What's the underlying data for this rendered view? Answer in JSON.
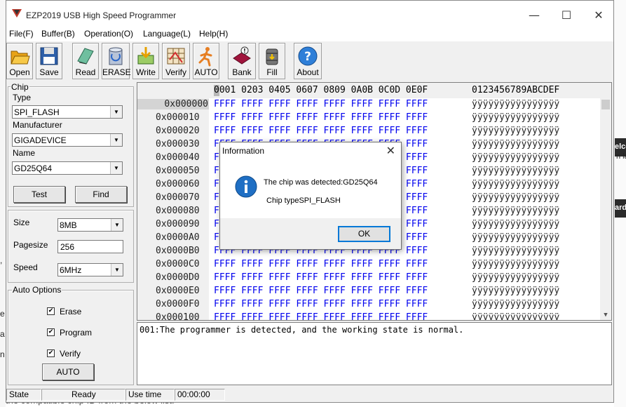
{
  "window": {
    "title": "EZP2019 USB High Speed Programmer",
    "minimize_glyph": "—",
    "maximize_glyph": "☐",
    "close_glyph": "✕"
  },
  "menu": [
    "File(F)",
    "Buffer(B)",
    "Operation(O)",
    "Language(L)",
    "Help(H)"
  ],
  "toolbar": {
    "open": "Open",
    "save": "Save",
    "read": "Read",
    "erase": "ERASE",
    "write": "Write",
    "verify": "Verify",
    "auto": "AUTO",
    "bank": "Bank",
    "fill": "Fill",
    "about": "About"
  },
  "chip": {
    "group_title": "Chip",
    "type_label": "Type",
    "type_value": "SPI_FLASH",
    "manufacturer_label": "Manufacturer",
    "manufacturer_value": "GIGADEVICE",
    "name_label": "Name",
    "name_value": "GD25Q64",
    "test_button": "Test",
    "find_button": "Find"
  },
  "params": {
    "size_label": "Size",
    "size_value": "8MB",
    "pagesize_label": "Pagesize",
    "pagesize_value": "256",
    "speed_label": "Speed",
    "speed_value": "6MHz"
  },
  "auto_options": {
    "group_title": "Auto Options",
    "erase": "Erase",
    "program": "Program",
    "verify": "Verify",
    "check_glyph": "✔",
    "auto_button": "AUTO"
  },
  "hex": {
    "header_offsets": "0001 0203 0405 0607 0809 0A0B 0C0D 0E0F",
    "header_ascii": "0123456789ABCDEF",
    "rows": [
      {
        "addr": "0x000000",
        "data": "FFFF FFFF FFFF FFFF FFFF FFFF FFFF FFFF",
        "ascii": "ÿÿÿÿÿÿÿÿÿÿÿÿÿÿÿÿ"
      },
      {
        "addr": "0x000010",
        "data": "FFFF FFFF FFFF FFFF FFFF FFFF FFFF FFFF",
        "ascii": "ÿÿÿÿÿÿÿÿÿÿÿÿÿÿÿÿ"
      },
      {
        "addr": "0x000020",
        "data": "FFFF FFFF FFFF FFFF FFFF FFFF FFFF FFFF",
        "ascii": "ÿÿÿÿÿÿÿÿÿÿÿÿÿÿÿÿ"
      },
      {
        "addr": "0x000030",
        "data": "FFFF FFFF FFFF FFFF FFFF FFFF FFFF FFFF",
        "ascii": "ÿÿÿÿÿÿÿÿÿÿÿÿÿÿÿÿ"
      },
      {
        "addr": "0x000040",
        "data": "FFFF FFFF FFFF FFFF FFFF FFFF FFFF FFFF",
        "ascii": "ÿÿÿÿÿÿÿÿÿÿÿÿÿÿÿÿ"
      },
      {
        "addr": "0x000050",
        "data": "FFFF FFFF FFFF FFFF FFFF FFFF FFFF FFFF",
        "ascii": "ÿÿÿÿÿÿÿÿÿÿÿÿÿÿÿÿ"
      },
      {
        "addr": "0x000060",
        "data": "FFFF FFFF FFFF FFFF FFFF FFFF FFFF FFFF",
        "ascii": "ÿÿÿÿÿÿÿÿÿÿÿÿÿÿÿÿ"
      },
      {
        "addr": "0x000070",
        "data": "FFFF FFFF FFFF FFFF FFFF FFFF FFFF FFFF",
        "ascii": "ÿÿÿÿÿÿÿÿÿÿÿÿÿÿÿÿ"
      },
      {
        "addr": "0x000080",
        "data": "FFFF FFFF FFFF FFFF FFFF FFFF FFFF FFFF",
        "ascii": "ÿÿÿÿÿÿÿÿÿÿÿÿÿÿÿÿ"
      },
      {
        "addr": "0x000090",
        "data": "FFFF FFFF FFFF FFFF FFFF FFFF FFFF FFFF",
        "ascii": "ÿÿÿÿÿÿÿÿÿÿÿÿÿÿÿÿ"
      },
      {
        "addr": "0x0000A0",
        "data": "FFFF FFFF FFFF FFFF FFFF FFFF FFFF FFFF",
        "ascii": "ÿÿÿÿÿÿÿÿÿÿÿÿÿÿÿÿ"
      },
      {
        "addr": "0x0000B0",
        "data": "FFFF FFFF FFFF FFFF FFFF FFFF FFFF FFFF",
        "ascii": "ÿÿÿÿÿÿÿÿÿÿÿÿÿÿÿÿ"
      },
      {
        "addr": "0x0000C0",
        "data": "FFFF FFFF FFFF FFFF FFFF FFFF FFFF FFFF",
        "ascii": "ÿÿÿÿÿÿÿÿÿÿÿÿÿÿÿÿ"
      },
      {
        "addr": "0x0000D0",
        "data": "FFFF FFFF FFFF FFFF FFFF FFFF FFFF FFFF",
        "ascii": "ÿÿÿÿÿÿÿÿÿÿÿÿÿÿÿÿ"
      },
      {
        "addr": "0x0000E0",
        "data": "FFFF FFFF FFFF FFFF FFFF FFFF FFFF FFFF",
        "ascii": "ÿÿÿÿÿÿÿÿÿÿÿÿÿÿÿÿ"
      },
      {
        "addr": "0x0000F0",
        "data": "FFFF FFFF FFFF FFFF FFFF FFFF FFFF FFFF",
        "ascii": "ÿÿÿÿÿÿÿÿÿÿÿÿÿÿÿÿ"
      },
      {
        "addr": "0x000100",
        "data": "FFFF FFFF FFFF FFFF FFFF FFFF FFFF FFFF",
        "ascii": "ÿÿÿÿÿÿÿÿÿÿÿÿÿÿÿÿ"
      }
    ]
  },
  "log": {
    "line1": "001:The programmer is detected, and the working state is normal."
  },
  "status": {
    "state_label": "State",
    "state_value": "Ready",
    "use_time_label": "Use time",
    "use_time_value": "00:00:00"
  },
  "dialog": {
    "title": "Information",
    "close_glyph": "✕",
    "line1": "The chip was detected:GD25Q64",
    "line2": "Chip typeSPI_FLASH",
    "ok_button": "OK"
  },
  "background": {
    "frag_top_right_1": "elco",
    "frag_top_right_2": "n la",
    "frag_mid_right": "ard",
    "frag_left_comma": ",",
    "frag_left_e": "e",
    "frag_left_a": "a",
    "frag_left_n": "n",
    "bottom_text": "the compatible chip ID from the below list."
  },
  "colors": {
    "hex_data": "#0000ee",
    "dialog_ok_border": "#0078d7",
    "info_icon": "#1f6fc4"
  }
}
